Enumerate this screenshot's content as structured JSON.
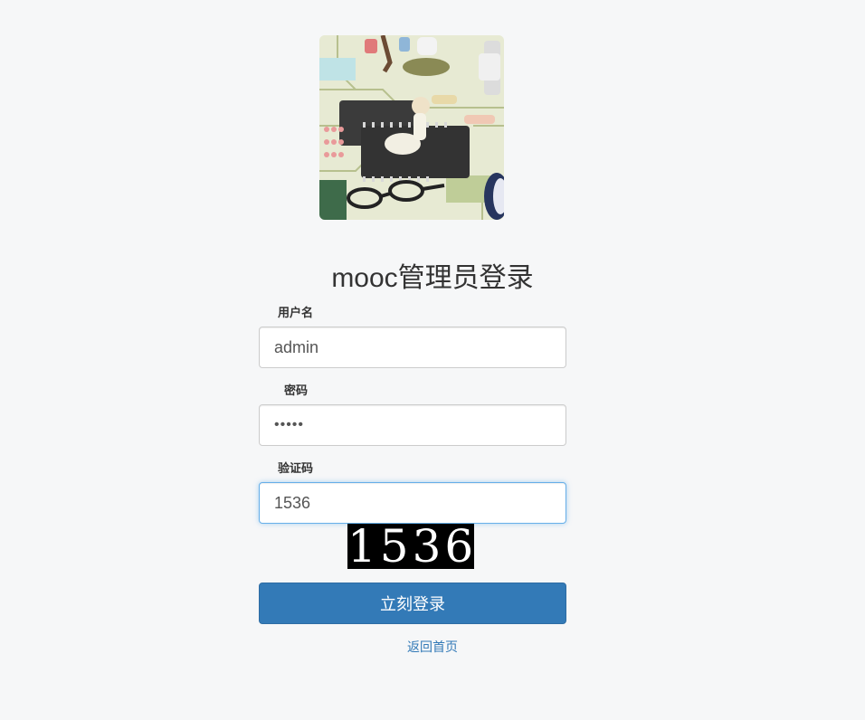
{
  "title": "mooc管理员登录",
  "form": {
    "username_label": "用户名",
    "username_value": "admin",
    "password_label": "密码",
    "password_value": "•••••",
    "captcha_label": "验证码",
    "captcha_value": "1536",
    "captcha_image_text": "1536",
    "submit_label": "立刻登录"
  },
  "home_link": "返回首页",
  "colors": {
    "primary": "#337ab7",
    "background": "#f6f7f8",
    "focus_border": "#66afe9"
  }
}
